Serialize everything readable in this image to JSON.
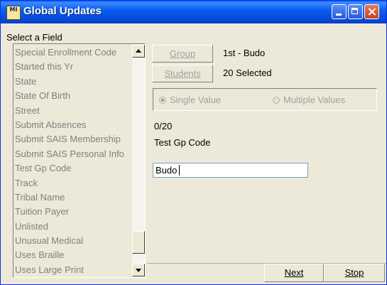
{
  "window": {
    "title": "Global Updates",
    "icon_text": "MI"
  },
  "field_selector": {
    "label": "Select a Field",
    "items": [
      "Special Enrollment Code",
      "Started this Yr",
      "State",
      "State Of Birth",
      "Street",
      "Submit Absences",
      "Submit SAIS Membership",
      "Submit SAIS Personal Info",
      "Test Gp Code",
      "Track",
      "Tribal Name",
      "Tuition Payer",
      "Unlisted",
      "Unusual Medical",
      "Uses Braille",
      "Uses Large Print"
    ]
  },
  "group_button": {
    "label": "Group",
    "value": "1st - Budo"
  },
  "students_button": {
    "label": "Students",
    "value": "20 Selected"
  },
  "value_mode": {
    "single": "Single Value",
    "multiple": "Multiple Values",
    "selected": "single"
  },
  "progress": {
    "counter": "0/20"
  },
  "current_field": "Test Gp Code",
  "value_input": {
    "value": "Budo"
  },
  "footer": {
    "next_label": "Next",
    "stop_label": "Stop"
  },
  "colors": {
    "titlebar": "#0b5ef0",
    "face": "#ece9d8",
    "disabled_text": "#808080"
  }
}
